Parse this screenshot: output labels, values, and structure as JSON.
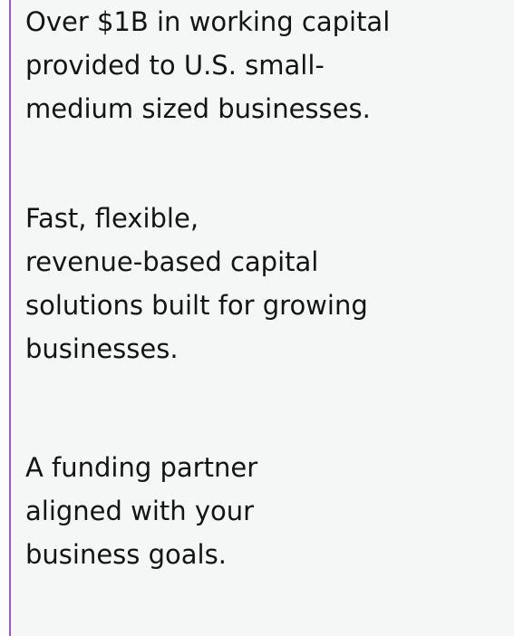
{
  "colors": {
    "accent": "#9b59d0",
    "background": "#f5f6f6",
    "text": "#141414"
  },
  "statements": [
    {
      "lines": [
        "Over $1B in working capital",
        "provided to U.S. small-",
        "medium sized businesses."
      ]
    },
    {
      "lines": [
        "Fast, flexible,",
        "revenue-based capital",
        "solutions built for growing",
        "businesses."
      ]
    },
    {
      "lines": [
        "A funding partner",
        "aligned with your",
        "business goals."
      ]
    }
  ]
}
